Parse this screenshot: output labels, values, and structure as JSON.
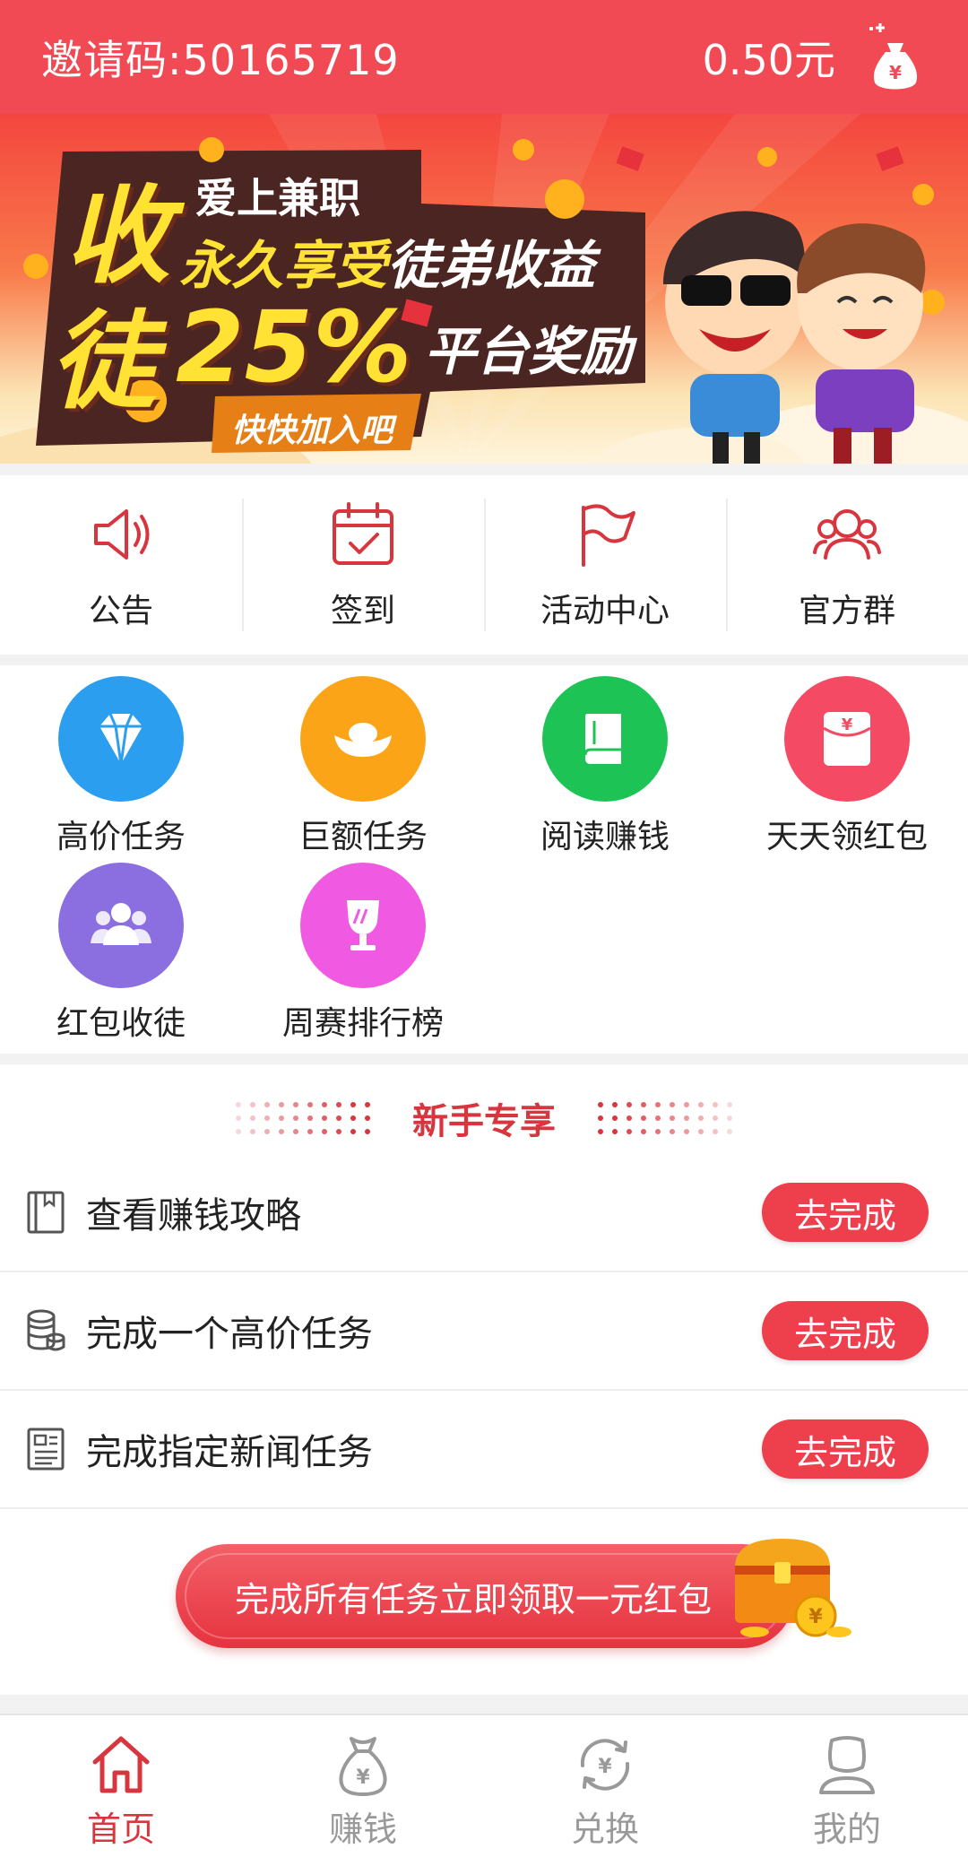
{
  "header": {
    "invite_code": "邀请码:50165719",
    "balance": "0.50元",
    "wallet_icon": "money-bag-icon"
  },
  "banner": {
    "char1": "收",
    "char2": "徒",
    "line1": "爱上兼职",
    "line2a": "永久享受",
    "line2b": "徒弟收益",
    "percent": "25%",
    "line3": "平台奖励",
    "cta": "快快加入吧"
  },
  "quick_menu": [
    {
      "label": "公告",
      "icon": "speaker-icon"
    },
    {
      "label": "签到",
      "icon": "calendar-check-icon"
    },
    {
      "label": "活动中心",
      "icon": "flag-icon"
    },
    {
      "label": "官方群",
      "icon": "group-icon"
    }
  ],
  "features": [
    {
      "label": "高价任务",
      "icon": "diamond-icon",
      "color": "#2b9ef0"
    },
    {
      "label": "巨额任务",
      "icon": "gold-ingot-icon",
      "color": "#fba418"
    },
    {
      "label": "阅读赚钱",
      "icon": "book-icon",
      "color": "#1ec356"
    },
    {
      "label": "天天领红包",
      "icon": "red-envelope-icon",
      "color": "#f44a63"
    },
    {
      "label": "红包收徒",
      "icon": "people-icon",
      "color": "#8b6fe0"
    },
    {
      "label": "周赛排行榜",
      "icon": "trophy-icon",
      "color": "#f05ae2"
    }
  ],
  "newbie": {
    "title": "新手专享",
    "tasks": [
      {
        "text": "查看赚钱攻略",
        "button": "去完成",
        "icon": "guide-book-icon"
      },
      {
        "text": "完成一个高价任务",
        "button": "去完成",
        "icon": "coins-icon"
      },
      {
        "text": "完成指定新闻任务",
        "button": "去完成",
        "icon": "news-icon"
      }
    ],
    "reward_text": "完成所有任务立即领取一元红包"
  },
  "bottom_nav": [
    {
      "label": "首页",
      "icon": "home-icon",
      "active": true
    },
    {
      "label": "赚钱",
      "icon": "money-bag-icon",
      "active": false
    },
    {
      "label": "兑换",
      "icon": "exchange-icon",
      "active": false
    },
    {
      "label": "我的",
      "icon": "user-icon",
      "active": false
    }
  ],
  "colors": {
    "primary": "#f14a55",
    "accent": "#d8363f"
  }
}
